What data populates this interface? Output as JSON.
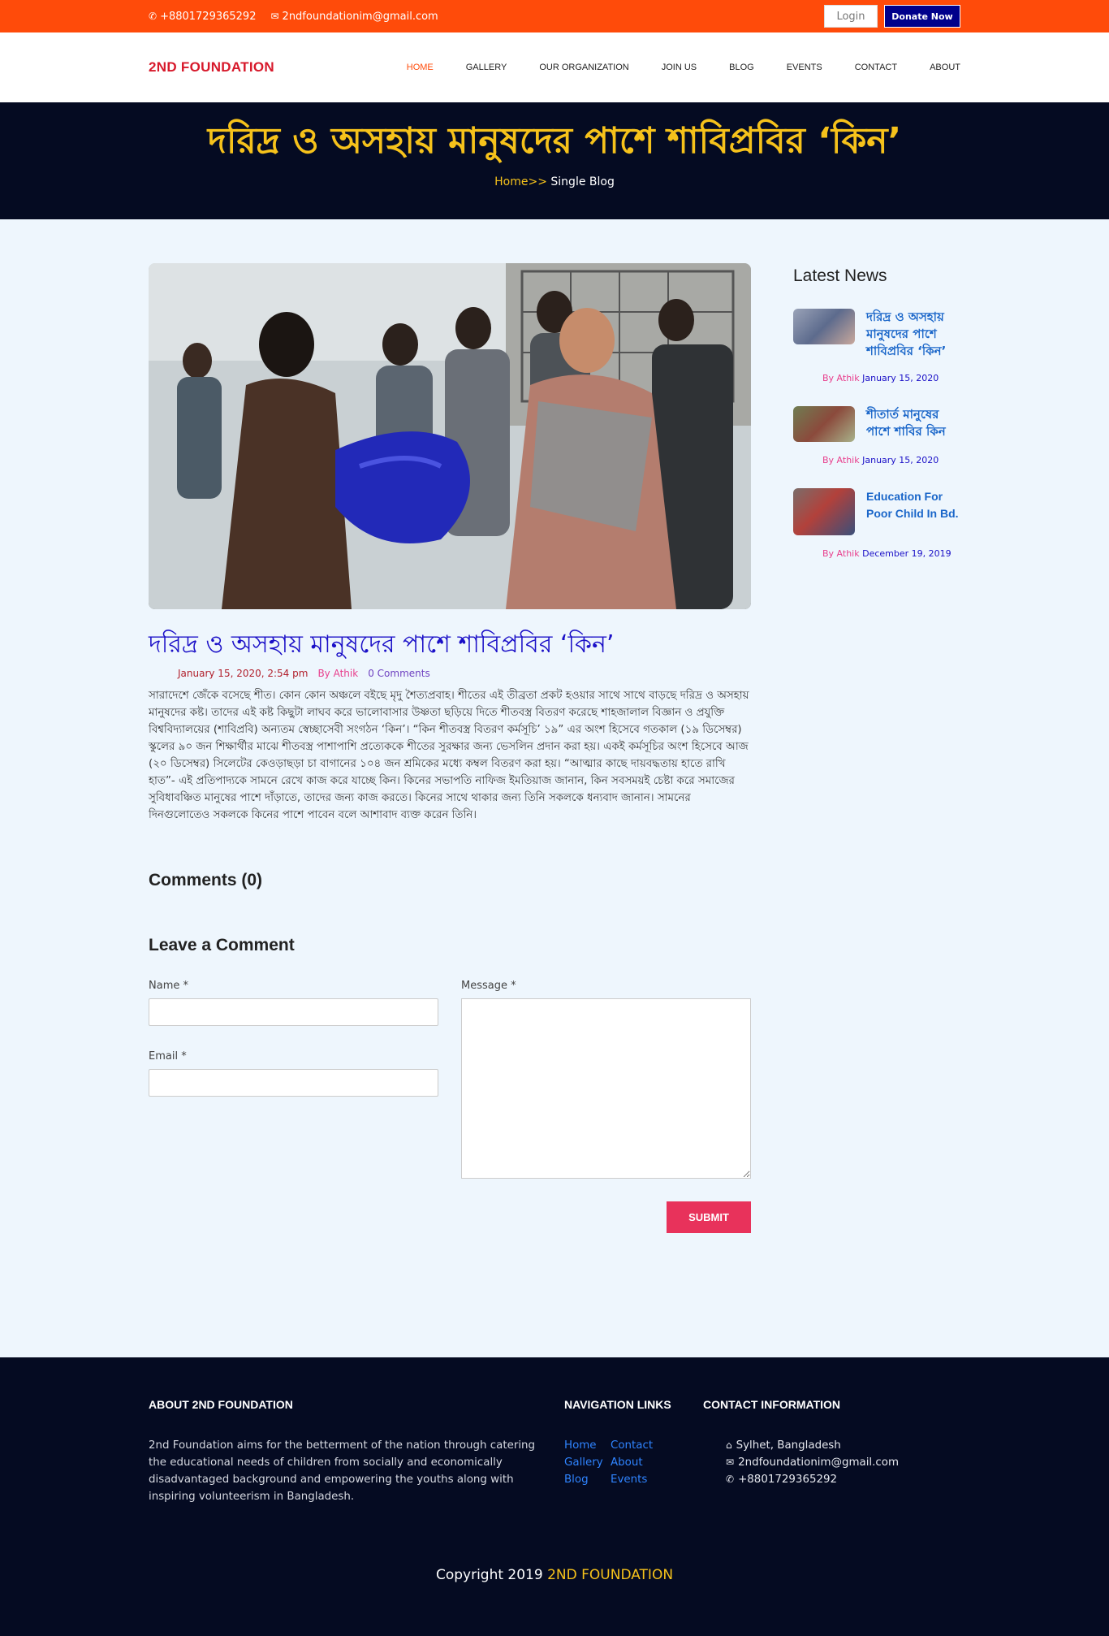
{
  "topbar": {
    "phone": "+8801729365292",
    "email": "2ndfoundationim@gmail.com",
    "login_label": "Login",
    "donate_label": "Donate Now",
    "phone_icon": "phone-icon",
    "mail_icon": "envelope-icon"
  },
  "nav": {
    "logo": "2ND FOUNDATION",
    "items": [
      {
        "label": "HOME"
      },
      {
        "label": "GALLERY"
      },
      {
        "label": "OUR ORGANIZATION"
      },
      {
        "label": "JOIN US"
      },
      {
        "label": "BLOG"
      },
      {
        "label": "EVENTS"
      },
      {
        "label": "CONTACT"
      },
      {
        "label": "ABOUT"
      }
    ]
  },
  "hero": {
    "title": "দরিদ্র ও অসহায় মানুষদের পাশে শাবিপ্রবির ‘কিন’",
    "crumb_home": "Home>>",
    "crumb_current": " Single Blog"
  },
  "post": {
    "title": "দরিদ্র ও অসহায় মানুষদের পাশে শাবিপ্রবির ‘কিন’",
    "date": "January 15, 2020, 2:54 pm",
    "by": "By Athik",
    "comments": "0 Comments",
    "body": "সারাদেশে জেঁকে বসেছে শীত। কোন কোন অঞ্চলে বইছে মৃদু শৈত্যপ্রবাহ। শীতের এই তীব্রতা প্রকট হওয়ার সাথে সাথে বাড়ছে দরিদ্র ও অসহায় মানুষদের কষ্ট। তাদের এই কষ্ট কিছুটা লাঘব করে ভালোবাসার উষ্ণতা ছড়িয়ে দিতে শীতবস্ত্র বিতরণ করেছে শাহজালাল বিজ্ঞান ও প্রযুক্তি বিশ্ববিদ্যালয়ের (শাবিপ্রবি) অন্যতম স্বেচ্ছাসেবী সংগঠন ‘কিন’। “কিন শীতবস্ত্র বিতরণ কর্মসূচি’ ১৯” এর অংশ হিসেবে গতকাল (১৯ ডিসেম্বর) স্কুলের ৯০ জন শিক্ষার্থীর মাঝে শীতবস্ত্র পাশাপাশি প্রত্যেককে শীতের সুরক্ষার জন্য ভেসলিন প্রদান করা হয়। একই কর্মসূচির অংশ হিসেবে আজ (২০ ডিসেম্বর) সিলেটের কেওড়াছড়া চা বাগানের ১০৪ জন শ্রমিকের মধ্যে কম্বল বিতরণ করা হয়। “আত্মার কাছে দায়বদ্ধতায় হাতে রাখি হাত”- এই প্রতিপাদ্যকে সামনে রেখে কাজ করে যাচ্ছে কিন। কিনের সভাপতি নাফিজ ইমতিয়াজ জানান, কিন সবসময়ই চেষ্টা করে সমাজের সুবিধাবঞ্চিত মানুষের পাশে দাঁড়াতে, তাদের জন্য কাজ করতে। কিনের সাথে থাকার জন্য তিনি সকলকে ধন্যবাদ জানান। সামনের দিনগুলোতেও সকলকে কিনের পাশে পাবেন বলে আশাবাদ ব্যক্ত করেন তিনি।"
  },
  "comments": {
    "title": "Comments (0)",
    "leave_title": "Leave a Comment",
    "name_label": "Name *",
    "email_label": "Email *",
    "message_label": "Message *",
    "submit_label": "SUBMIT"
  },
  "sidebar": {
    "title": "Latest News",
    "items": [
      {
        "title": "দরিদ্র ও অসহায় মানুষদের পাশে শাবিপ্রবির ‘কিন’",
        "by": "By Athik",
        "date": " January 15, 2020"
      },
      {
        "title": "শীতার্ত মানুষের পাশে শাবির কিন",
        "by": "By Athik",
        "date": " January 15, 2020"
      },
      {
        "title": "Education For Poor Child In Bd.",
        "by": "By Athik",
        "date": " December 19, 2019"
      }
    ]
  },
  "footer": {
    "about_title": "ABOUT 2ND FOUNDATION",
    "about_text": "2nd Foundation aims for the betterment of the nation through catering the educational needs of children from socially and economically disadvantaged background and empowering the youths along with inspiring volunteerism in Bangladesh.",
    "nav_title": "NAVIGATION LINKS",
    "links": [
      "Home",
      "Contact",
      "Gallery",
      "About",
      "Blog",
      "Events"
    ],
    "contact_title": "CONTACT INFORMATION",
    "address": "Sylhet, Bangladesh",
    "email": "2ndfoundationim@gmail.com",
    "phone": "+8801729365292",
    "copyright_prefix": "Copyright 2019 ",
    "copyright_brand": "2ND FOUNDATION"
  },
  "colors": {
    "topbar": "#ff4b0a",
    "donate": "#00008b",
    "logo": "#d7192b",
    "hero_bg": "#050b22",
    "hero_title": "#f6c21b",
    "post_title": "#1a0fc7",
    "submit": "#e8325b"
  }
}
